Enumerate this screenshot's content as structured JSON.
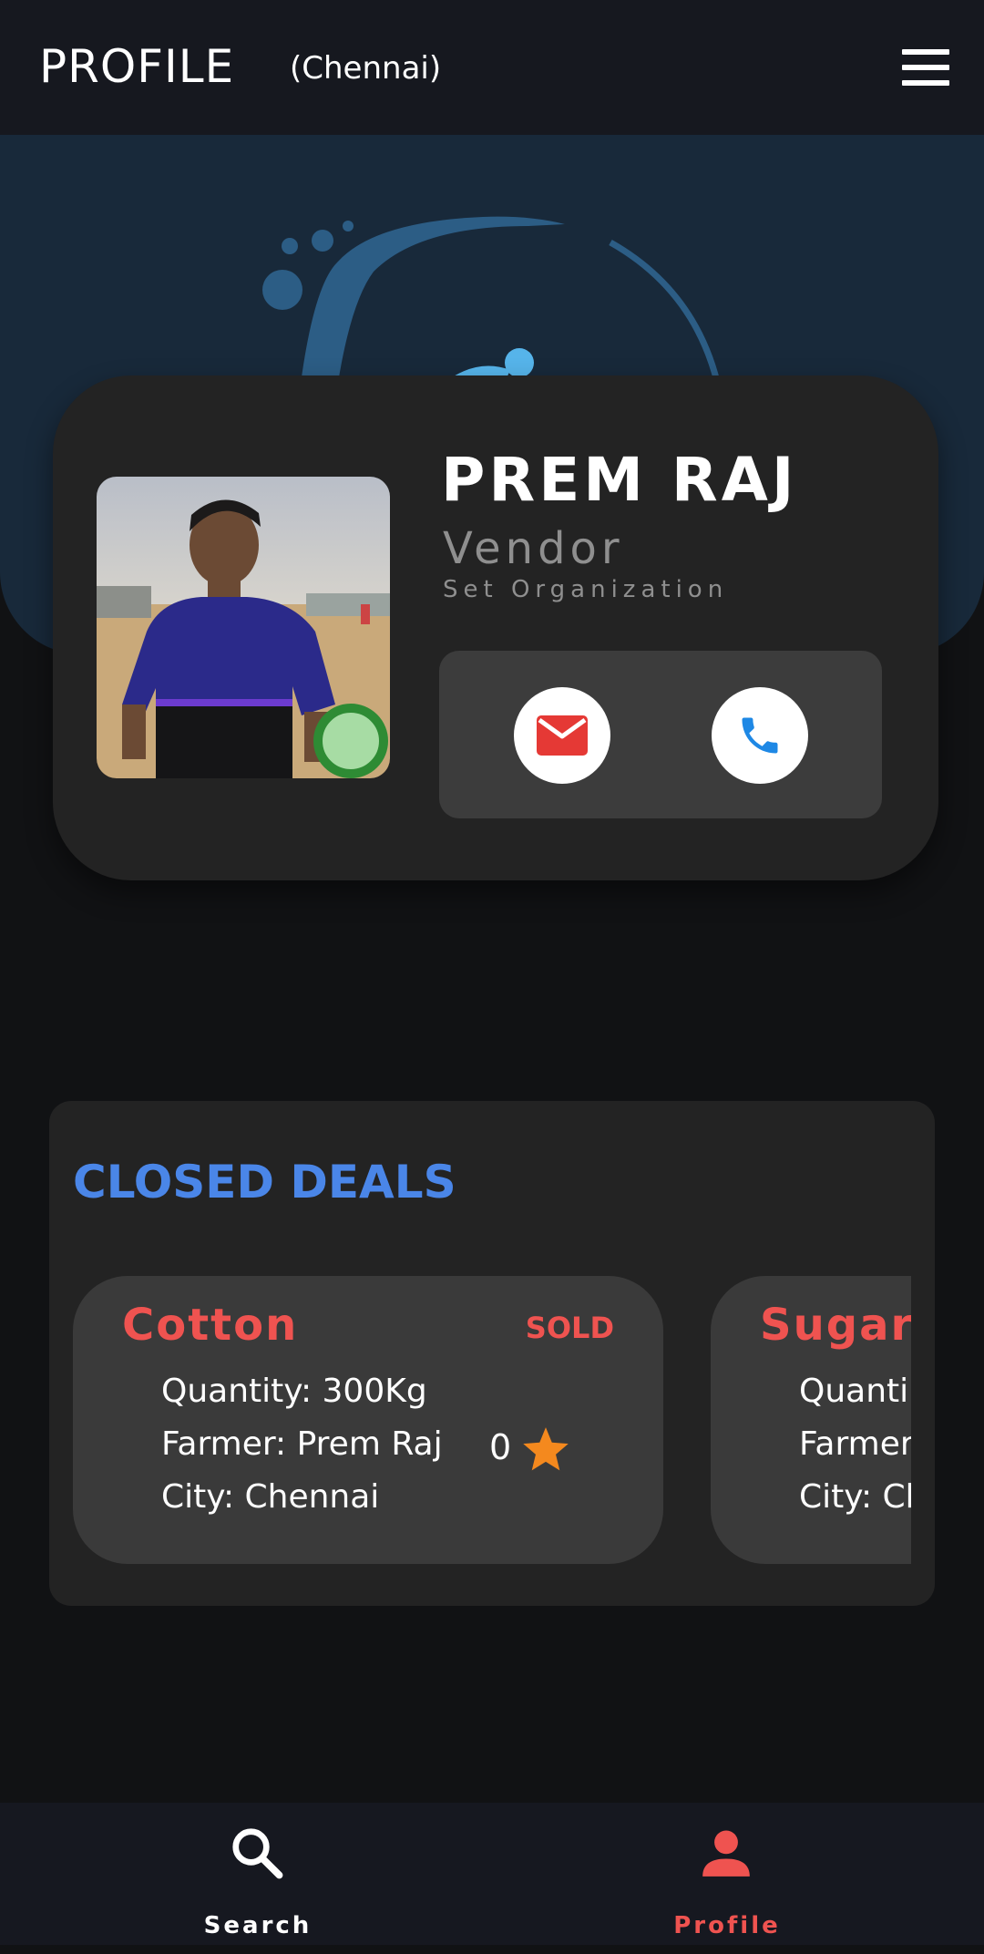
{
  "header": {
    "title": "PROFILE",
    "location": "(Chennai)"
  },
  "profile": {
    "name": "PREM RAJ",
    "role": "Vendor",
    "organization": "Set Organization",
    "online": true
  },
  "deals": {
    "title": "CLOSED DEALS",
    "items": [
      {
        "crop": "Cotton",
        "status": "SOLD",
        "quantity": "Quantity:  300Kg",
        "farmer": "Farmer: Prem Raj",
        "city": "City: Chennai",
        "rating": "0"
      },
      {
        "crop": "Sugarc",
        "quantity": "Quanti",
        "farmer": "Farmer",
        "city": "City: Ch"
      }
    ]
  },
  "nav": {
    "items": [
      {
        "label": "Search",
        "icon": "search-icon",
        "active": false
      },
      {
        "label": "Profile",
        "icon": "person-icon",
        "active": true
      }
    ]
  },
  "colors": {
    "accent_blue": "#4a86e8",
    "accent_red": "#ef5350",
    "online_green": "#2e8b34",
    "star": "#f4891e"
  }
}
